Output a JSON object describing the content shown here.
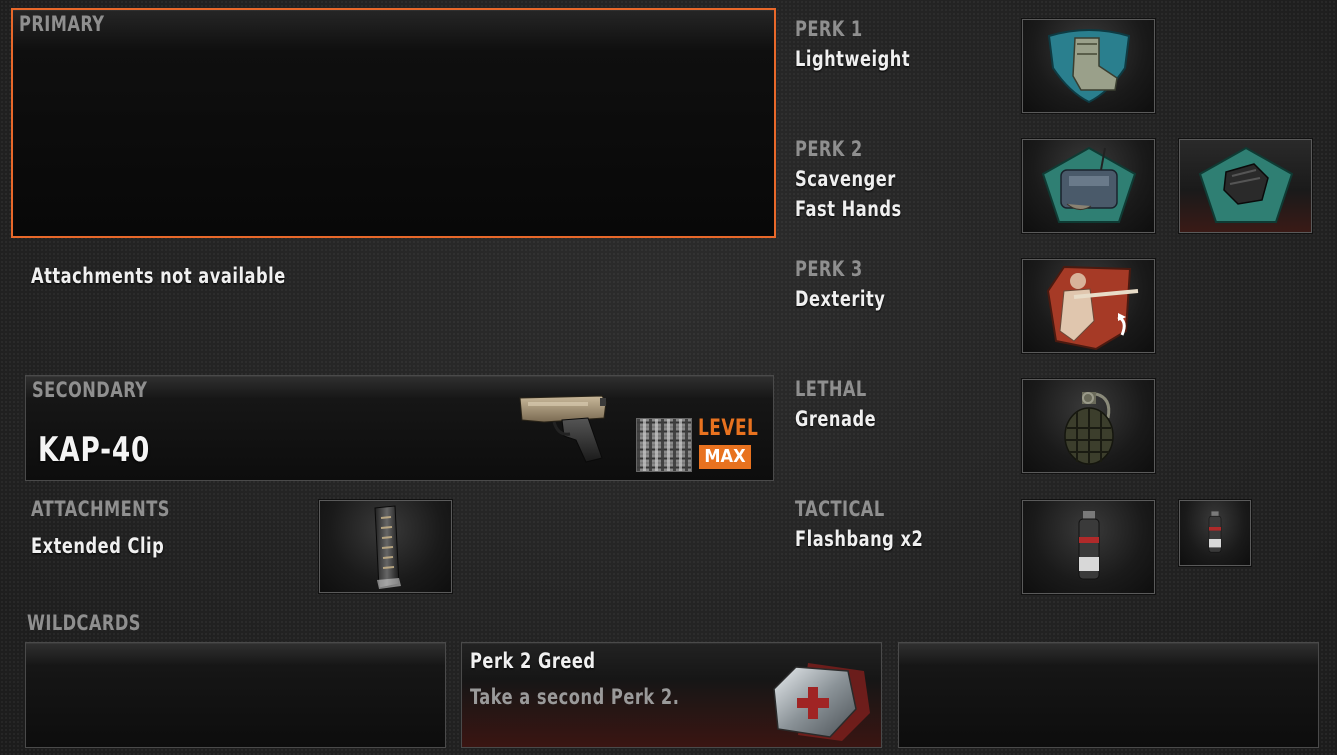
{
  "primary": {
    "label": "PRIMARY"
  },
  "primary_attachments": {
    "status": "Attachments not available"
  },
  "secondary": {
    "label": "SECONDARY",
    "weapon": "KAP-40",
    "level_label": "LEVEL",
    "level_value": "MAX"
  },
  "attachments": {
    "label": "ATTACHMENTS",
    "value": "Extended Clip"
  },
  "wildcards": {
    "label": "WILDCARDS",
    "slots": [
      {
        "title": "",
        "desc": ""
      },
      {
        "title": "Perk 2 Greed",
        "desc": "Take a second Perk 2."
      },
      {
        "title": "",
        "desc": ""
      }
    ]
  },
  "perk1": {
    "label": "PERK 1",
    "value": "Lightweight"
  },
  "perk2": {
    "label": "PERK 2",
    "values": [
      "Scavenger",
      "Fast Hands"
    ]
  },
  "perk3": {
    "label": "PERK 3",
    "value": "Dexterity"
  },
  "lethal": {
    "label": "LETHAL",
    "value": "Grenade"
  },
  "tactical": {
    "label": "TACTICAL",
    "value": "Flashbang x2"
  },
  "colors": {
    "accent_orange": "#e8682a",
    "perk1_blue": "#2a7f8e",
    "perk2_green": "#2f7f73",
    "perk3_red": "#a63a26"
  }
}
